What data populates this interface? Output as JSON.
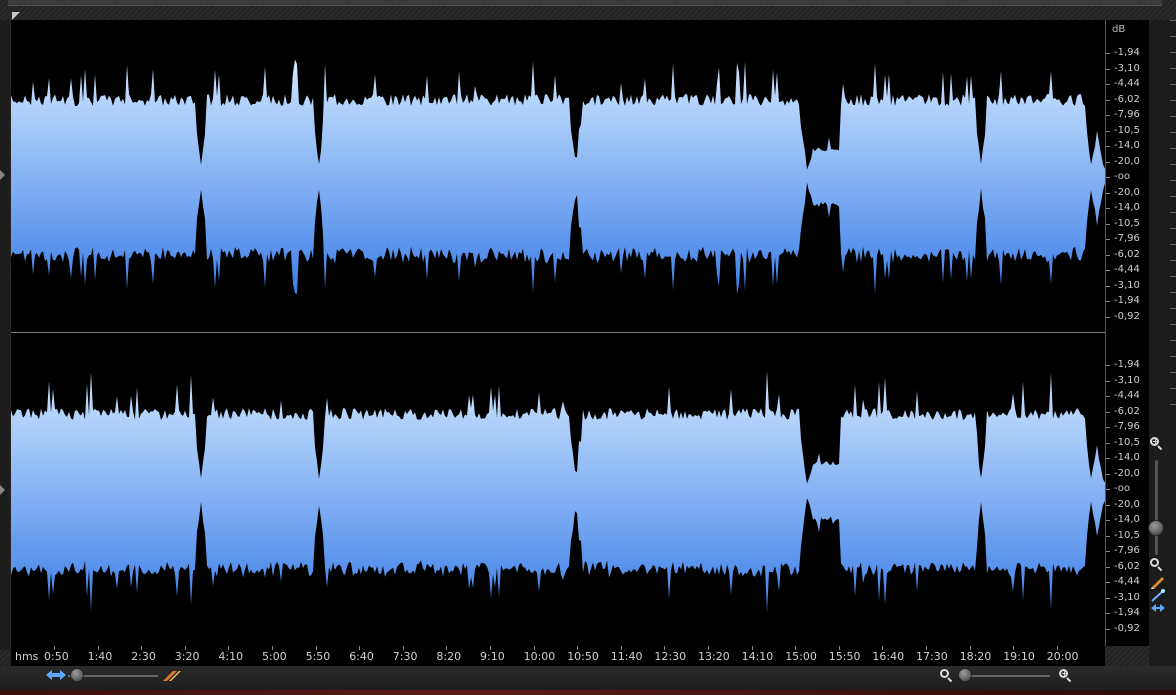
{
  "app": {
    "accent": "#6aa8f5",
    "waveform_top": "#cfe6ff",
    "waveform_bottom": "#3d7fe8",
    "background": "#000000"
  },
  "db_ruler": {
    "unit": "dB",
    "left_channel": [
      "-1,94",
      "-3,10",
      "-4,44",
      "-6,02",
      "-7,96",
      "-10,5",
      "-14,0",
      "-20,0",
      "-oo",
      "-20,0",
      "-14,0",
      "-10,5",
      "-7,96",
      "-6,02",
      "-4,44",
      "-3,10",
      "-1,94",
      "-0,92"
    ],
    "right_channel": [
      "-1,94",
      "-3,10",
      "-4,44",
      "-6,02",
      "-7,96",
      "-10,5",
      "-14,0",
      "-20,0",
      "-oo",
      "-20,0",
      "-14,0",
      "-10,5",
      "-7,96",
      "-6,02",
      "-4,44",
      "-3,10",
      "-1,94",
      "-0,92"
    ]
  },
  "time_ruler": {
    "unit": "hms",
    "labels": [
      "0:50",
      "1:40",
      "2:30",
      "3:20",
      "4:10",
      "5:00",
      "5:50",
      "6:40",
      "7:30",
      "8:20",
      "9:10",
      "10:00",
      "10:50",
      "11:40",
      "12:30",
      "13:20",
      "14:10",
      "15:00",
      "15:50",
      "16:40",
      "17:30",
      "18:20",
      "19:10",
      "20:00"
    ]
  },
  "controls": {
    "zoom_in_icon": "zoom-in-icon",
    "zoom_out_icon": "zoom-out-icon",
    "vertical_zoom_level": 0.72,
    "horizontal_zoom_level": 0.08,
    "time_zoom_level": 0.1
  }
}
